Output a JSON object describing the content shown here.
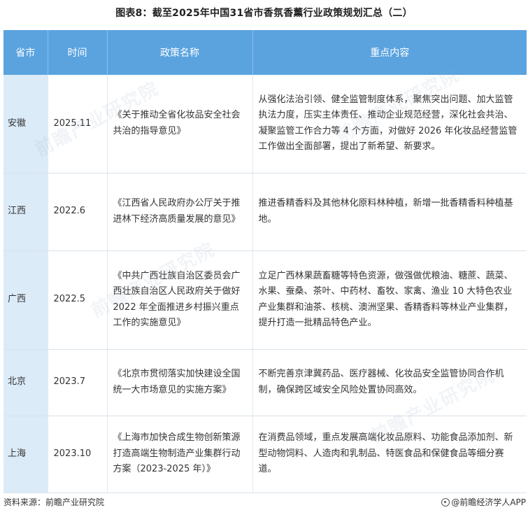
{
  "title": "图表8：截至2025年中国31省市香氛香薰行业政策规划汇总（二）",
  "table": {
    "headers": [
      "省市",
      "时间",
      "政策名称",
      "重点内容"
    ],
    "rows": [
      {
        "province": "安徽",
        "time": "2025.11",
        "policy": "《关于推动全省化妆品安全社会共治的指导意见》",
        "content": "从强化法治引领、健全监管制度体系，聚焦突出问题、加大监管执法力度，压实主体责任、推动企业规范经营，深化社会共治、凝聚监管工作合力等 4 个方面，对做好 2026 年化妆品经营监管工作做出全面部署，提出了新希望、新要求。"
      },
      {
        "province": "江西",
        "time": "2022.6",
        "policy": "《江西省人民政府办公厅关于推进林下经济高质量发展的意见》",
        "content": "推进香精香料及其他林化原料林种植，新增一批香精香料种植基地。"
      },
      {
        "province": "广西",
        "time": "2022.5",
        "policy": "《中共广西壮族自治区委员会广西壮族自治区人民政府关于做好 2022 年全面推进乡村振兴重点工作的实施意见》",
        "content": "立足广西林果蔬畜糖等特色资源，做强做优粮油、糖蔗、蔬菜、水果、蚕桑、茶叶、中药材、畜牧、家禽、渔业 10 大特色农业产业集群和油茶、核桃、澳洲坚果、香精香料等林业产业集群，提升打造一批精品特色产业。"
      },
      {
        "province": "北京",
        "time": "2023.7",
        "policy": "《北京市贯彻落实加快建设全国统一大市场意见的实施方案》",
        "content": "不断完善京津冀药品、医疗器械、化妆品安全监管协同合作机制，确保跨区域安全风险处置协同高效。"
      },
      {
        "province": "上海",
        "time": "2023.10",
        "policy": "《上海市加快合成生物创新策源 打造高端生物制造产业集群行动方案（2023-2025 年）》",
        "content": "在消费品领域，重点发展高端化妆品原料、功能食品添加剂、新型动物饲料、人造肉和乳制品、特医食品和保健食品等细分赛道。"
      }
    ]
  },
  "footer": {
    "source": "资料来源：前瞻产业研究院",
    "brand": "@前瞻经济学人APP"
  },
  "watermark_text": "前瞻产业研究院",
  "colors": {
    "header_bg": "#5aa3df",
    "province_col_bg": "#dcebf8"
  }
}
